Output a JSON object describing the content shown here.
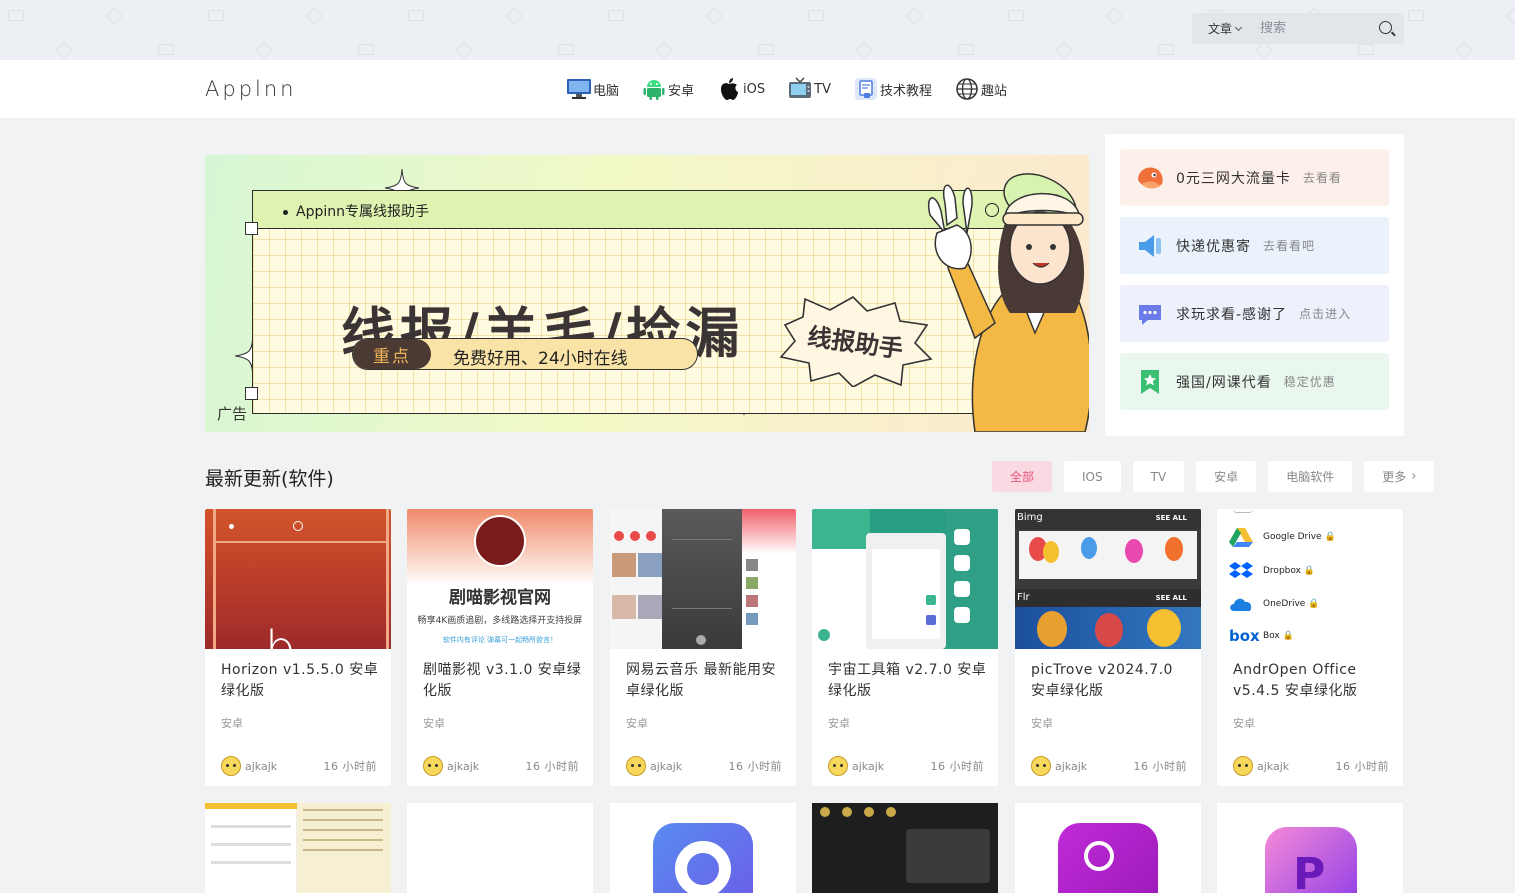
{
  "topbar": {
    "search_type": "文章",
    "search_placeholder": "搜索"
  },
  "header": {
    "logo": "Applnn",
    "nav": [
      {
        "label": "电脑",
        "icon": "computer-icon"
      },
      {
        "label": "安卓",
        "icon": "android-icon"
      },
      {
        "label": "iOS",
        "icon": "apple-icon"
      },
      {
        "label": "TV",
        "icon": "tv-icon"
      },
      {
        "label": "技术教程",
        "icon": "tutorial-icon"
      },
      {
        "label": "趣站",
        "icon": "globe-icon"
      }
    ]
  },
  "banner": {
    "card_title": "Appinn专属线报助手",
    "headline": "线报/羊毛/捡漏",
    "pill_tag": "重点",
    "pill_text": "免费好用、24小时在线",
    "burst_text": "线报助手",
    "ad_label": "广告"
  },
  "sidebar": [
    {
      "title": "0元三网大流量卡",
      "sub": "去看看",
      "icon": "fish-icon",
      "bg": "#fdf0ea",
      "color": "#f0703c"
    },
    {
      "title": "快递优惠寄",
      "sub": "去看看吧",
      "icon": "speaker-icon",
      "bg": "#eaf3fc",
      "color": "#4a9be8"
    },
    {
      "title": "求玩求看-感谢了",
      "sub": "点击进入",
      "icon": "chat-icon",
      "bg": "#eef0fc",
      "color": "#6b7ce8"
    },
    {
      "title": "强国/网课代看",
      "sub": "稳定优惠",
      "icon": "bookmark-star-icon",
      "bg": "#eaf7ef",
      "color": "#3bbf73"
    }
  ],
  "section": {
    "title": "最新更新(软件)",
    "filters": [
      "全部",
      "IOS",
      "TV",
      "安卓",
      "电脑软件",
      "更多"
    ]
  },
  "cards": [
    {
      "title": "Horizon v1.5.5.0 安卓绿化版",
      "category": "安卓",
      "author": "ajkajk",
      "time": "16 小时前",
      "thumb_text": "b"
    },
    {
      "title": "剧喵影视 v3.1.0 安卓绿化版",
      "category": "安卓",
      "author": "ajkajk",
      "time": "16 小时前",
      "thumb_text": "剧喵影视官网",
      "thumb_sub": "畅享4K画质追剧，多线路选择开支持投屏",
      "thumb_sub2": "软件内有评论 弹幕可一起畅所欲言！"
    },
    {
      "title": "网易云音乐 最新能用安卓绿化版",
      "category": "安卓",
      "author": "ajkajk",
      "time": "16 小时前"
    },
    {
      "title": "宇宙工具箱 v2.7.0 安卓绿化版",
      "category": "安卓",
      "author": "ajkajk",
      "time": "16 小时前"
    },
    {
      "title": "picTrove v2024.7.0 安卓绿化版",
      "category": "安卓",
      "author": "ajkajk",
      "time": "16 小时前",
      "thumb_label1": "Bimg",
      "thumb_label2": "Flr",
      "thumb_see": "SEE ALL"
    },
    {
      "title": "AndrOpen Office v5.4.5 安卓绿化版",
      "category": "安卓",
      "author": "ajkajk",
      "time": "16 小时前",
      "thumb_list": [
        "Google Drive",
        "Dropbox",
        "OneDrive",
        "Box"
      ]
    }
  ],
  "colors": {
    "accent_pink": "#e8547a",
    "banner_dark": "#3a3434"
  }
}
